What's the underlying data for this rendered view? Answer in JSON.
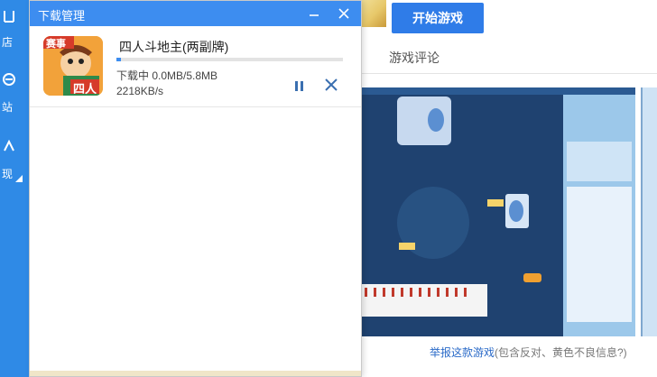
{
  "sidebar": {
    "items": [
      {
        "label": "店",
        "icon": "store-icon"
      },
      {
        "label": "站",
        "icon": "site-icon"
      },
      {
        "label": "现",
        "icon": "discover-icon"
      }
    ]
  },
  "page": {
    "start_button": "开始游戏",
    "tab_review": "游戏评论",
    "report_link": "举报这款游戏",
    "report_tail": "(包含反对、黄色不良信息?)"
  },
  "download_dialog": {
    "title": "下载管理",
    "item": {
      "name": "四人斗地主(两副牌)",
      "icon_badge": "赛事",
      "icon_text": "四人",
      "status": "下载中  0.0MB/5.8MB",
      "speed": "2218KB/s",
      "progress_fraction": 0.02
    }
  },
  "colors": {
    "accent": "#3d8df0",
    "sidebar": "#2f8ae6"
  }
}
